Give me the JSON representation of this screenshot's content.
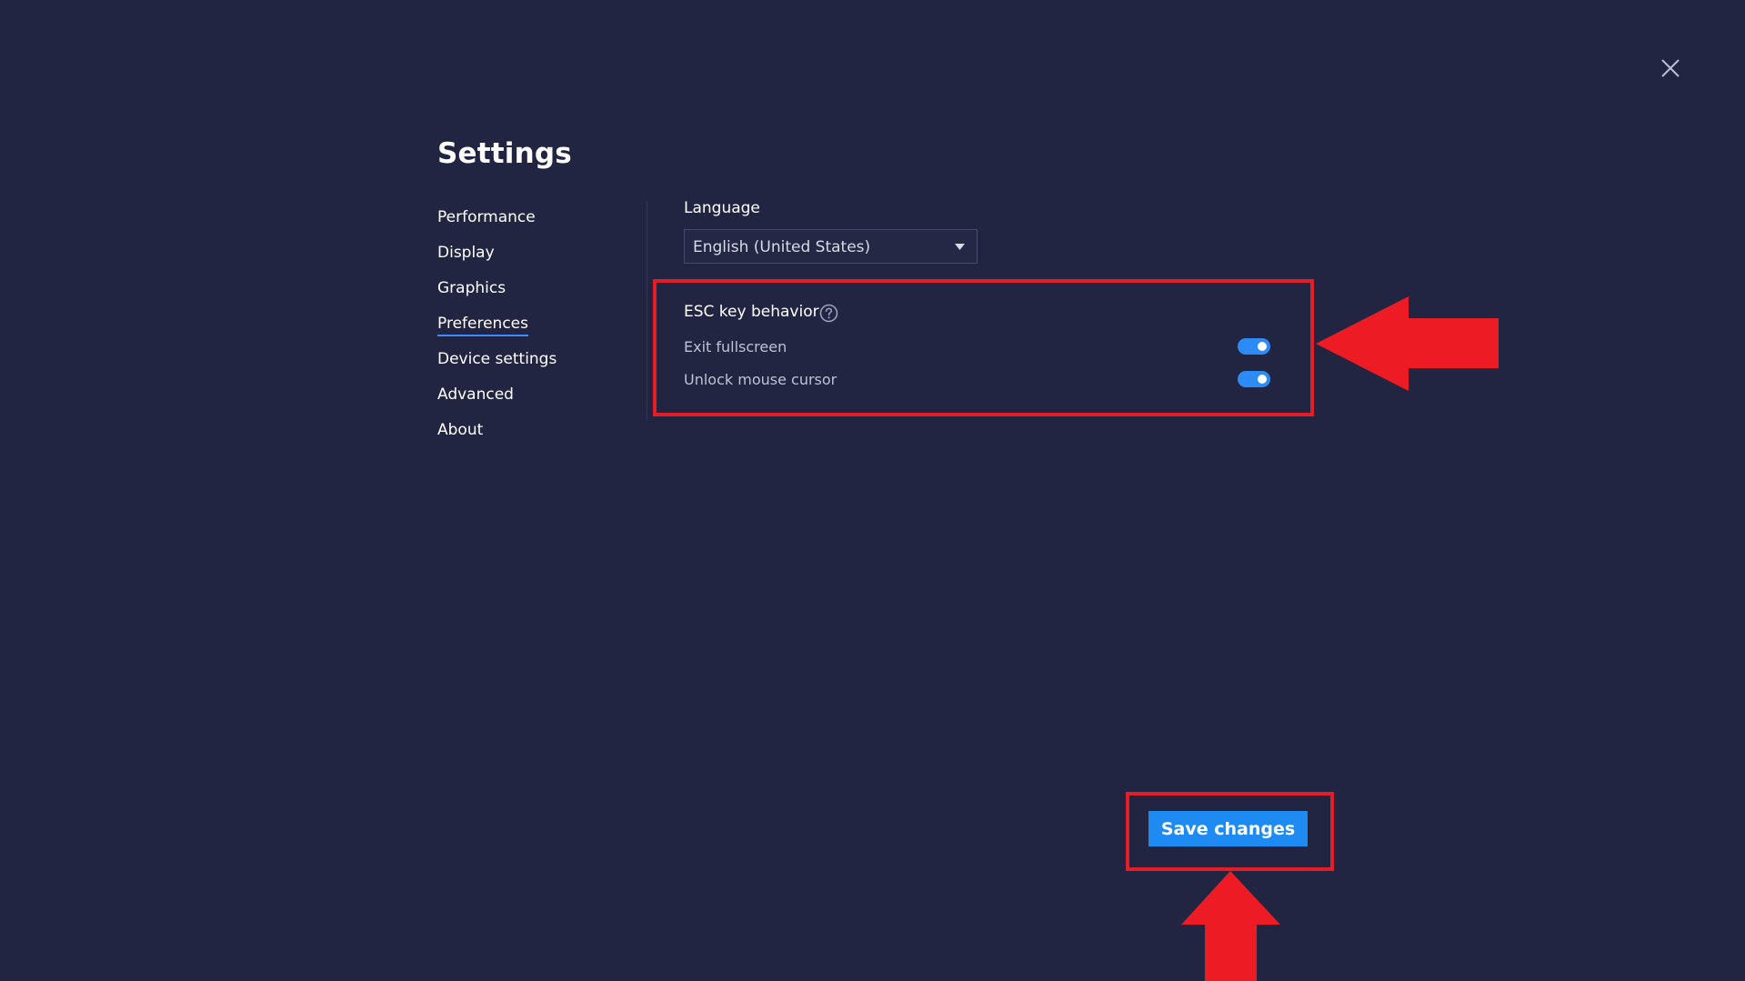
{
  "page": {
    "title": "Settings"
  },
  "close": {
    "icon": "close-icon"
  },
  "sidebar": {
    "items": [
      {
        "label": "Performance",
        "active": false
      },
      {
        "label": "Display",
        "active": false
      },
      {
        "label": "Graphics",
        "active": false
      },
      {
        "label": "Preferences",
        "active": true
      },
      {
        "label": "Device settings",
        "active": false
      },
      {
        "label": "Advanced",
        "active": false
      },
      {
        "label": "About",
        "active": false
      }
    ]
  },
  "language": {
    "label": "Language",
    "selected": "English (United States)",
    "icon": "caret-down-icon"
  },
  "esc": {
    "title": "ESC key behavior",
    "help_icon": "question-circle-icon",
    "options": [
      {
        "label": "Exit fullscreen",
        "enabled": true
      },
      {
        "label": "Unlock mouse cursor",
        "enabled": true
      }
    ]
  },
  "footer": {
    "save_label": "Save changes"
  },
  "colors": {
    "background": "#222541",
    "accent": "#1d8bf1",
    "toggle_on": "#2d8bf5",
    "annotation_red": "#e31e26",
    "active_underline": "#3d8bff"
  }
}
